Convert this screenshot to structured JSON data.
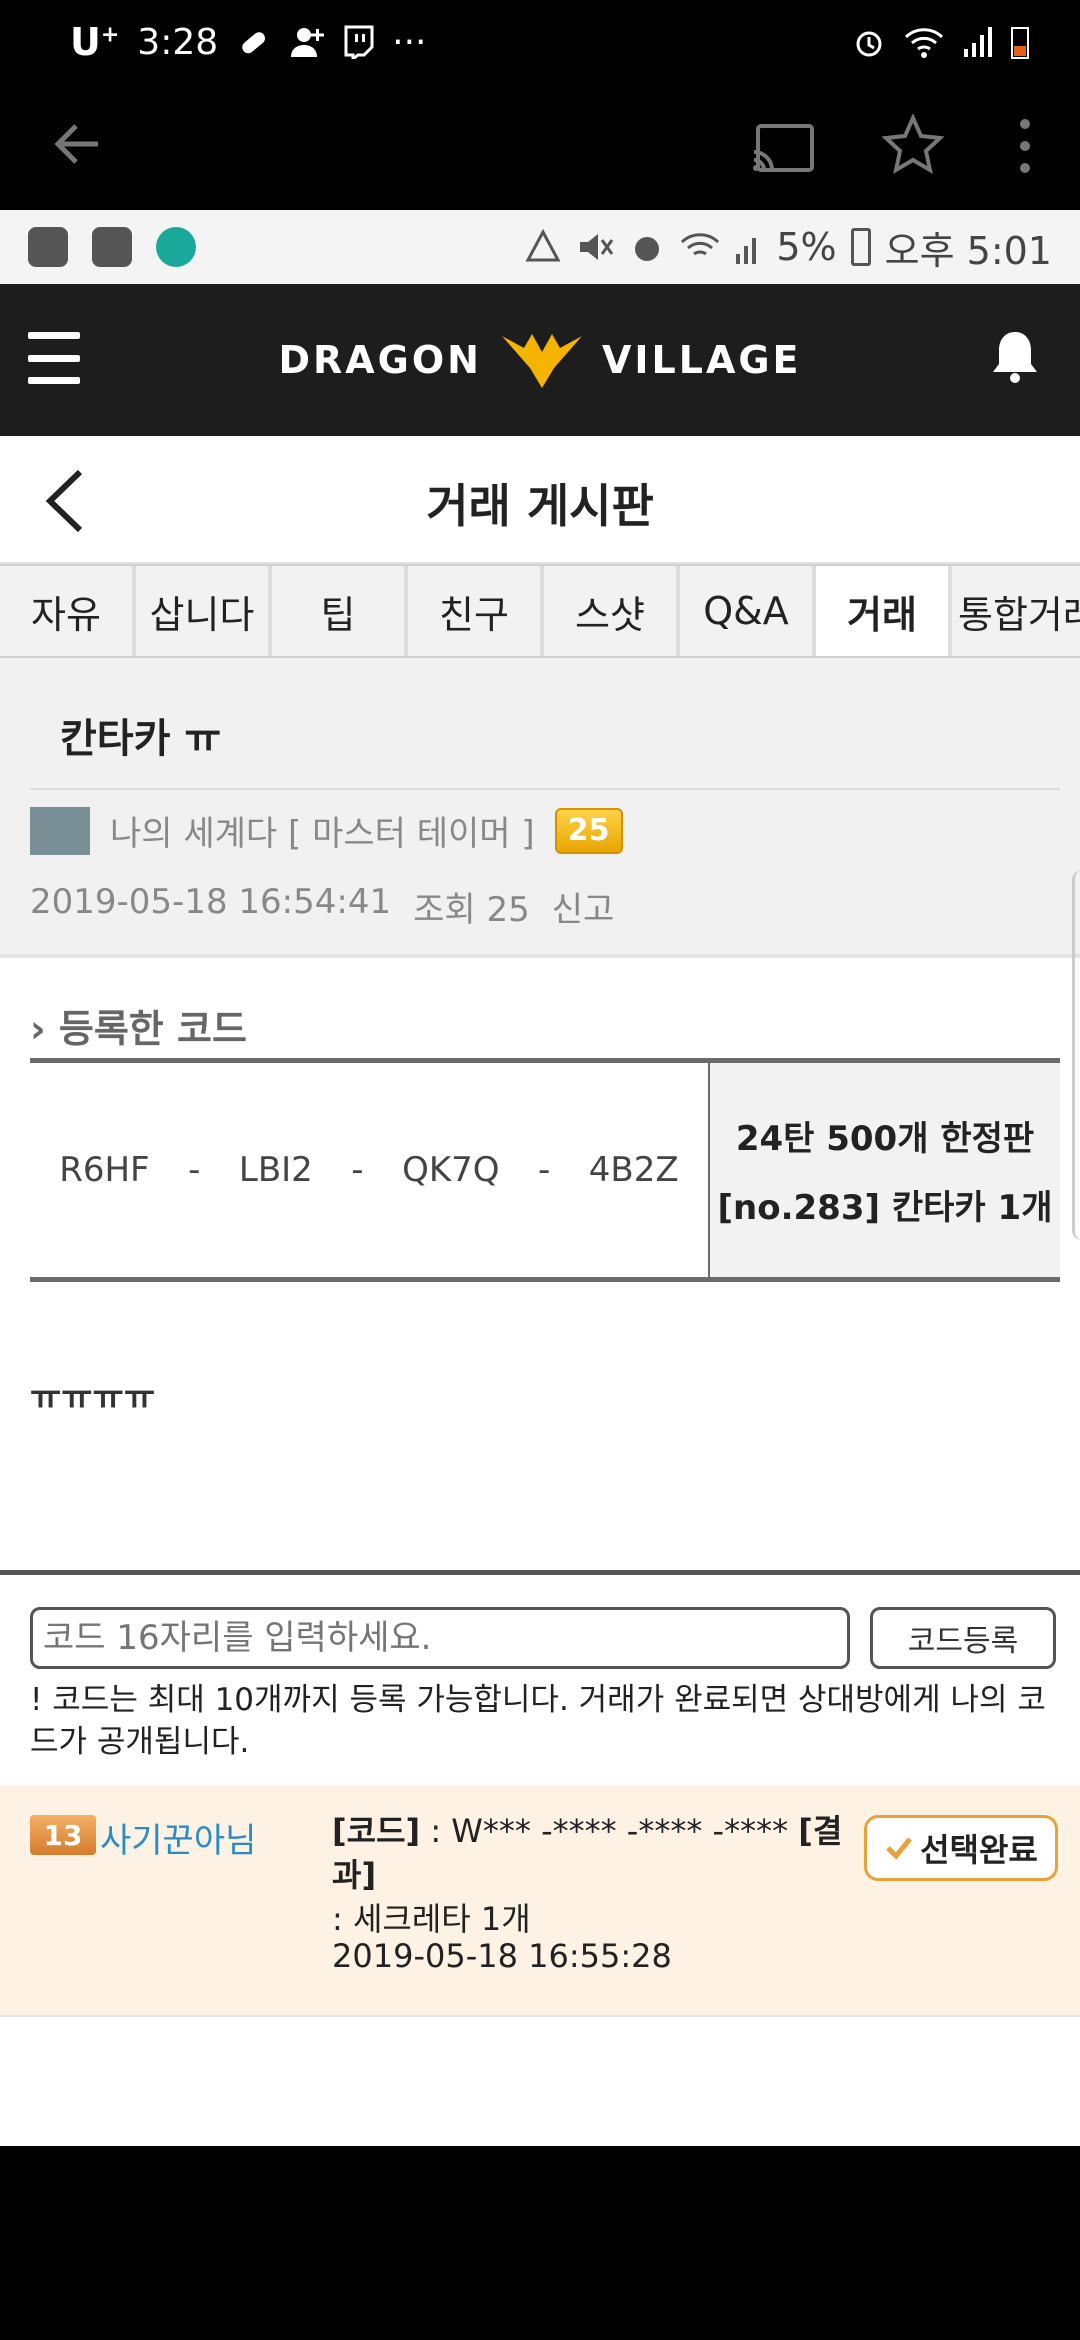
{
  "outer_status": {
    "carrier": "U",
    "carrier_sup": "+",
    "time": "3:28",
    "more": "···"
  },
  "inner_status": {
    "battery": "5%",
    "time": "오후 5:01"
  },
  "header": {
    "logo_left": "DRAGON",
    "logo_right": "VILLAGE"
  },
  "page": {
    "title": "거래 게시판"
  },
  "tabs": [
    "자유",
    "삽니다",
    "팁",
    "친구",
    "스샷",
    "Q&A",
    "거래",
    "통합거래"
  ],
  "active_tab": "거래",
  "post": {
    "title": "칸타카 ㅠ",
    "author": "나의 세계다 [ 마스터 테이머 ]",
    "level": "25",
    "date": "2019-05-18 16:54:41",
    "views": "조회 25",
    "report": "신고",
    "body": "ㅠㅠㅠㅠ"
  },
  "code_section": {
    "heading": "등록한 코드",
    "code_parts": [
      "R6HF",
      "-",
      "LBI2",
      "-",
      "QK7Q",
      "-",
      "4B2Z"
    ],
    "reward_line1": "24탄 500개 한정판",
    "reward_line2": "[no.283] 칸타카 1개"
  },
  "reply": {
    "input_placeholder": "코드 16자리를 입력하세요.",
    "submit_label": "코드등록",
    "notice": "! 코드는 최대 10개까지 등록 가능합니다. 거래가 완료되면 상대방에게 나의 코드가 공개됩니다."
  },
  "comment": {
    "level": "13",
    "user": "사기꾼아님",
    "code_label": "[코드]",
    "code_value": ": W*** -**** -**** -****",
    "result_label": "[결과]",
    "result_value": ": 세크레타 1개",
    "date": "2019-05-18 16:55:28",
    "select_label": "선택완료"
  },
  "colors": {
    "header_bg": "#1d1d1d",
    "logo_gold": "#f5b400",
    "comment_bg": "#fdf2e4",
    "user_blue": "#2b8ac9",
    "select_border": "#e8a23a"
  }
}
